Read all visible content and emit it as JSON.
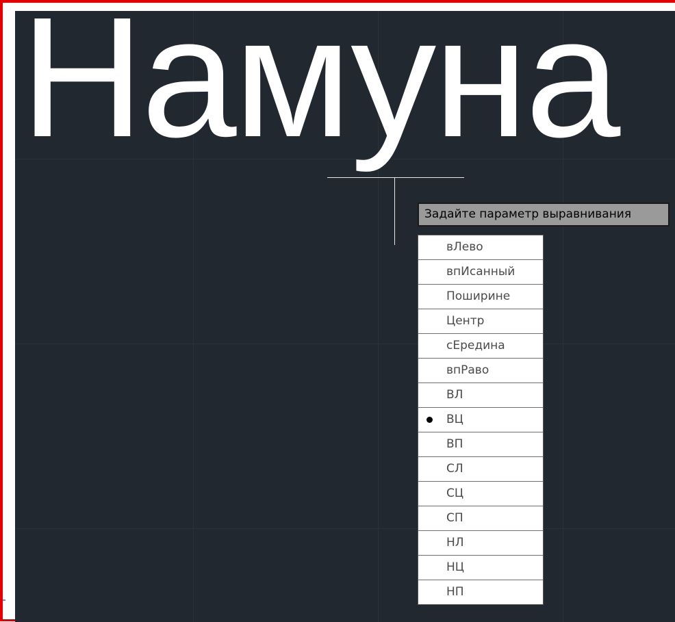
{
  "canvas": {
    "drawing_text": "Намуна"
  },
  "prompt": {
    "tooltip": "Задайте параметр выравнивания"
  },
  "justify_menu": {
    "items": [
      {
        "label": "вЛево",
        "selected": false
      },
      {
        "label": "впИсанный",
        "selected": false
      },
      {
        "label": "Поширине",
        "selected": false
      },
      {
        "label": "Центр",
        "selected": false
      },
      {
        "label": "сЕредина",
        "selected": false
      },
      {
        "label": "впРаво",
        "selected": false
      },
      {
        "label": "ВЛ",
        "selected": false
      },
      {
        "label": "ВЦ",
        "selected": true
      },
      {
        "label": "ВП",
        "selected": false
      },
      {
        "label": "СЛ",
        "selected": false
      },
      {
        "label": "СЦ",
        "selected": false
      },
      {
        "label": "СП",
        "selected": false
      },
      {
        "label": "НЛ",
        "selected": false
      },
      {
        "label": "НЦ",
        "selected": false
      },
      {
        "label": "НП",
        "selected": false
      }
    ]
  },
  "colors": {
    "background": "#212830",
    "frame": "#e00000",
    "text": "#ffffff",
    "tooltip_bg": "#9a9a9a"
  }
}
